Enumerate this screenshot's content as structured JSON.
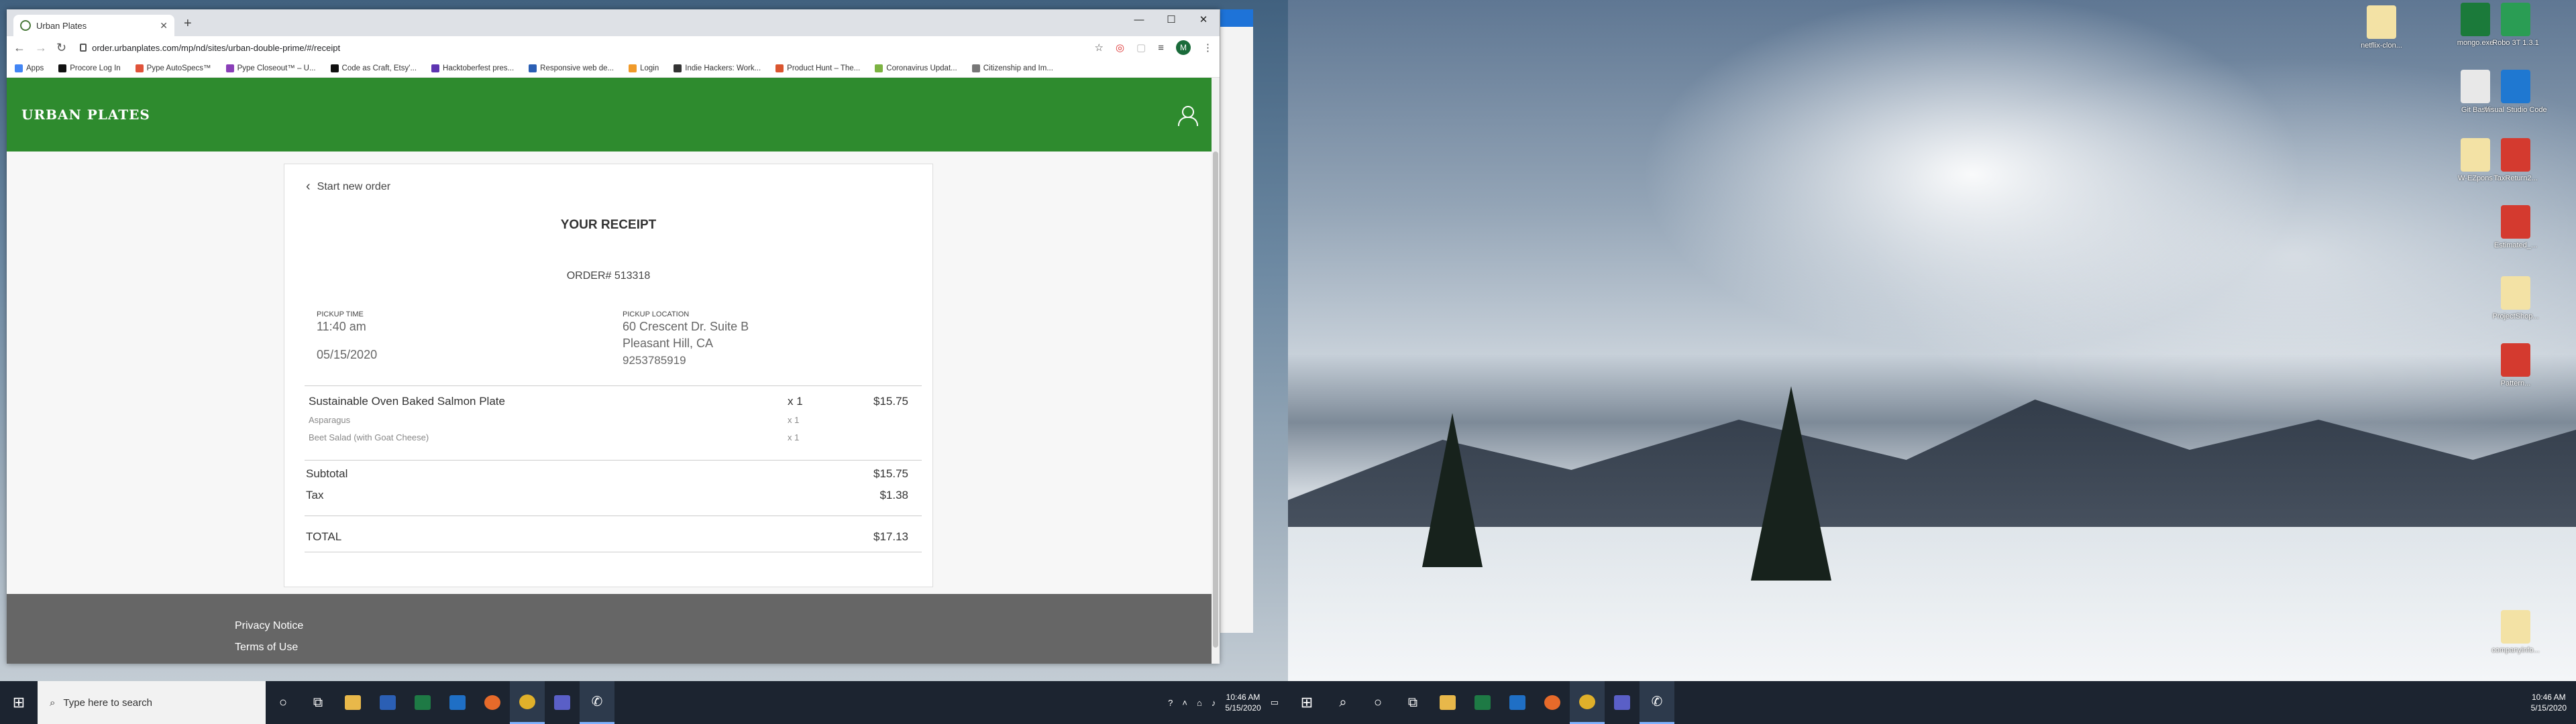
{
  "browser": {
    "tab_title": "Urban Plates",
    "url": "order.urbanplates.com/mp/nd/sites/urban-double-prime/#/receipt",
    "profile_initial": "M",
    "bookmarks": [
      "Apps",
      "Procore Log In",
      "Pype AutoSpecs™",
      "Pype Closeout™ – U...",
      "Code as Craft, Etsy'...",
      "Hacktoberfest pres...",
      "Responsive web de...",
      "Login",
      "Indie Hackers: Work...",
      "Product Hunt – The...",
      "Coronavirus Updat...",
      "Citizenship and Im..."
    ],
    "bookmark_colors": [
      "#4285f4",
      "#111111",
      "#e0533a",
      "#8a3fb8",
      "#111111",
      "#5e35b1",
      "#2b5fb4",
      "#f09a2a",
      "#333333",
      "#da552f",
      "#7cb342",
      "#777777"
    ]
  },
  "site": {
    "logo": "URBAN PLATES",
    "back_link": "Start new order",
    "receipt_title": "YOUR RECEIPT",
    "order_number": "ORDER# 513318",
    "pickup_time_label": "PICKUP TIME",
    "pickup_time": "11:40 am",
    "pickup_date": "05/15/2020",
    "pickup_location_label": "PICKUP LOCATION",
    "location_line1": "60 Crescent Dr. Suite B",
    "location_line2": "Pleasant Hill, CA",
    "location_phone": "9253785919",
    "item": {
      "name": "Sustainable Oven Baked Salmon Plate",
      "qty": "x 1",
      "price": "$15.75"
    },
    "sides": [
      {
        "name": "Asparagus",
        "qty": "x 1"
      },
      {
        "name": "Beet Salad (with Goat Cheese)",
        "qty": "x 1"
      }
    ],
    "subtotal_label": "Subtotal",
    "subtotal": "$15.75",
    "tax_label": "Tax",
    "tax": "$1.38",
    "total_label": "TOTAL",
    "total": "$17.13",
    "footer_links": [
      "Privacy Notice",
      "Terms of Use"
    ]
  },
  "desktop_icons": [
    {
      "label": "netflix-clon...",
      "color": "#f3e2a5"
    },
    {
      "label": "mongo.exe",
      "color": "#1b7a3a"
    },
    {
      "label": "Robo 3T 1.3.1",
      "color": "#2a9d54"
    },
    {
      "label": "Git Bash",
      "color": "#e8e8e8"
    },
    {
      "label": "Visual Studio Code",
      "color": "#1f78d1"
    },
    {
      "label": "W-EZpons",
      "color": "#f3e2a5"
    },
    {
      "label": "TaxReturn2...",
      "color": "#d43a2f"
    },
    {
      "label": "Estimated_...",
      "color": "#d43a2f"
    },
    {
      "label": "ProjectShop...",
      "color": "#f3e2a5"
    },
    {
      "label": "Pattern...",
      "color": "#d43a2f"
    },
    {
      "label": "companyinfo...",
      "color": "#f3e2a5"
    }
  ],
  "taskbar": {
    "search_placeholder": "Type here to search",
    "time": "10:46 AM",
    "date": "5/15/2020",
    "time2": "10:46 AM",
    "date2": "5/15/2020"
  }
}
